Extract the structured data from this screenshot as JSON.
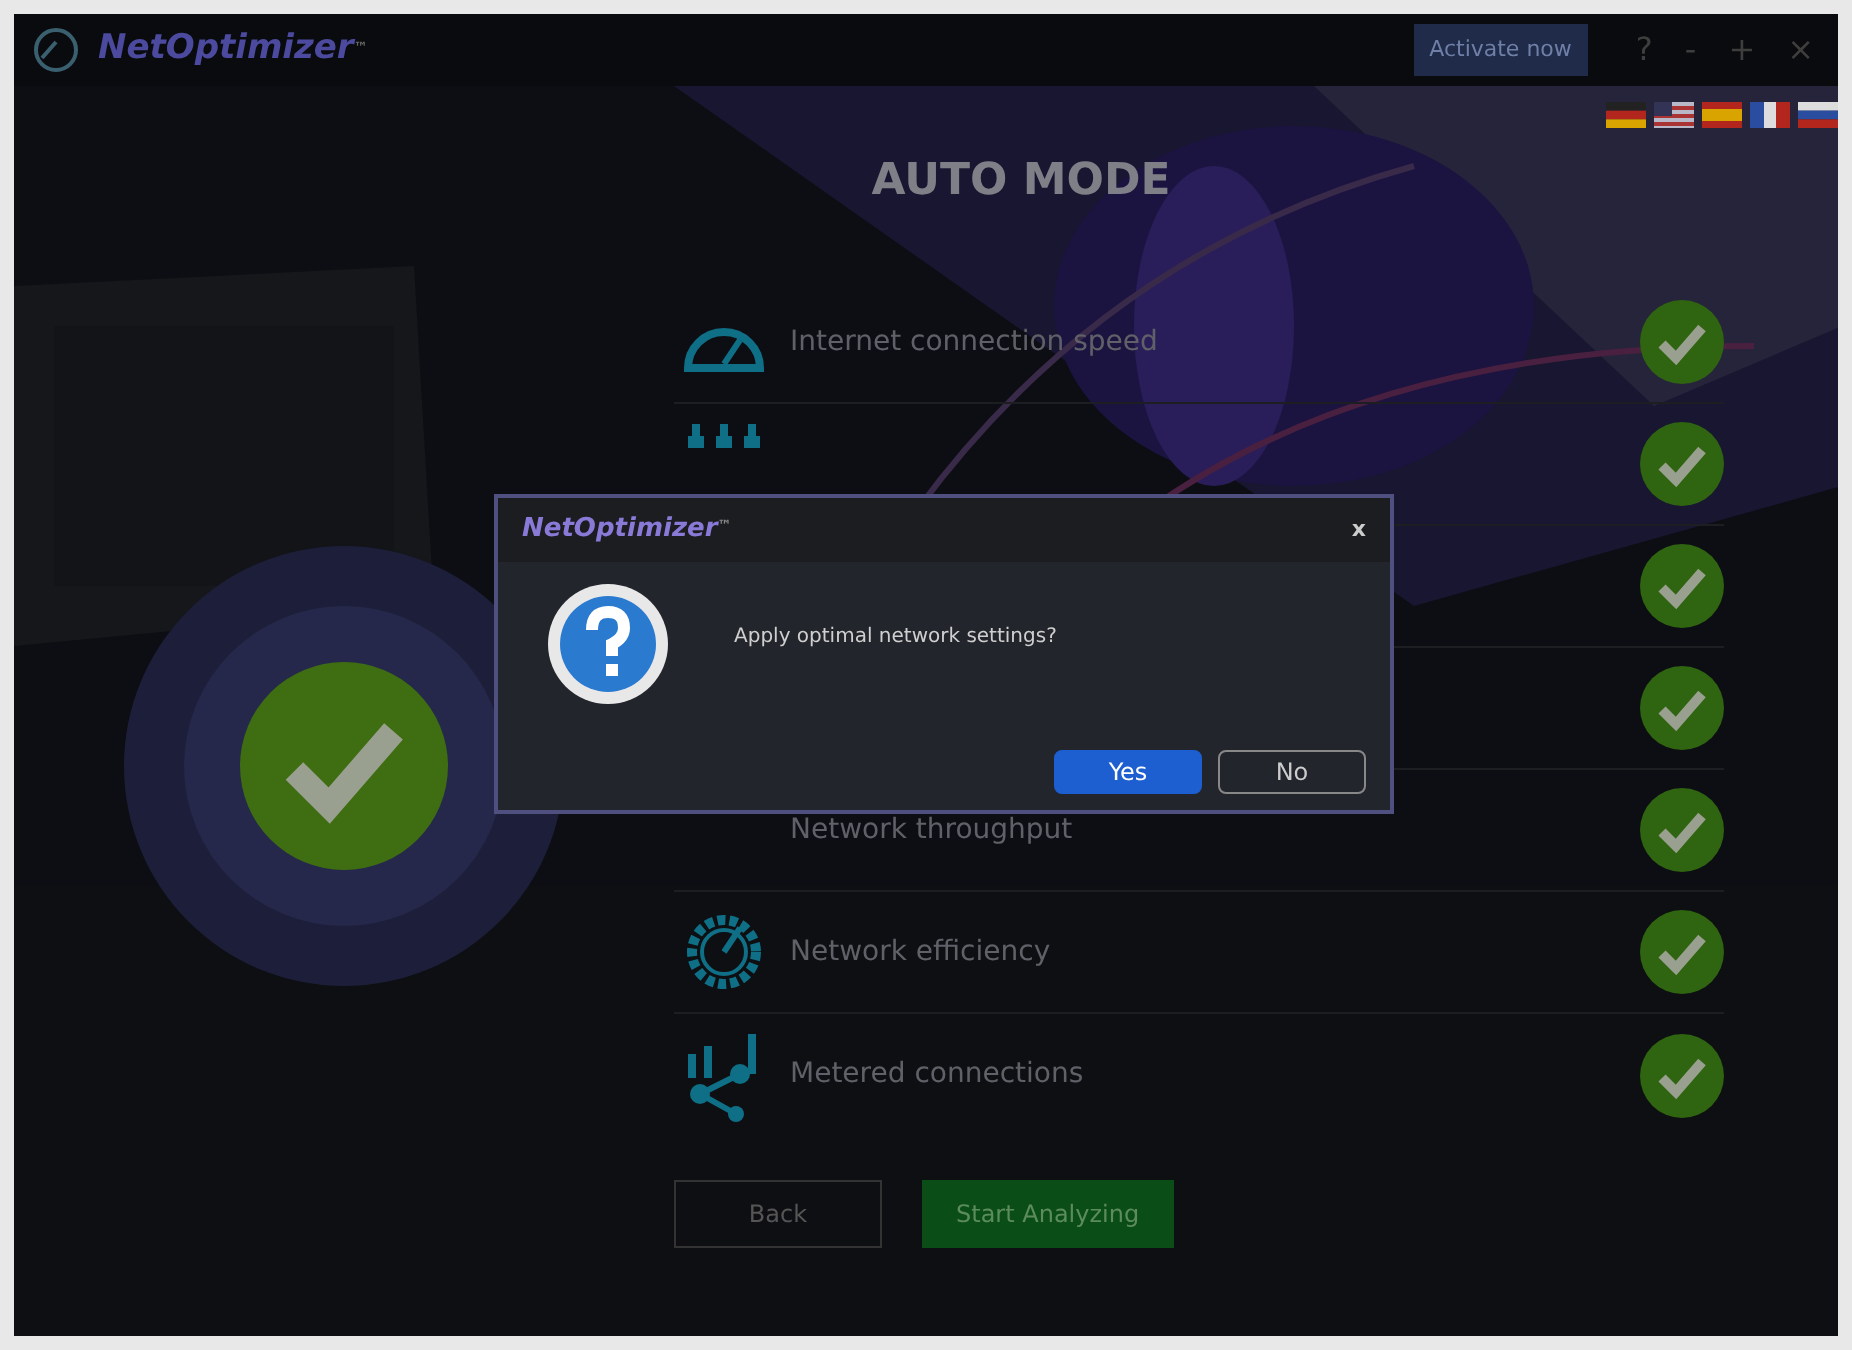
{
  "header": {
    "logo": "NetOptimizer",
    "logo_mark": "™",
    "activate": "Activate now",
    "controls": [
      "?",
      "-",
      "+",
      "×"
    ]
  },
  "flags": [
    {
      "kind": "de"
    },
    {
      "kind": "us"
    },
    {
      "kind": "es"
    },
    {
      "kind": "fr"
    },
    {
      "kind": "ru"
    }
  ],
  "title": "AUTO MODE",
  "status": {
    "checked": true
  },
  "rows": [
    {
      "kind": "gauge",
      "label": "Internet connection speed",
      "checked": true
    },
    {
      "kind": "bars",
      "checked": true
    },
    {
      "checked": true
    },
    {
      "checked": true
    },
    {
      "label": "Network throughput",
      "checked": true
    },
    {
      "kind": "gear",
      "label": "Network efficiency",
      "checked": true
    },
    {
      "kind": "nodes",
      "label": "Metered connections",
      "checked": true
    }
  ],
  "buttons": [
    {
      "kind": "outline",
      "label": "Back"
    },
    {
      "kind": "primary",
      "label": "Start Analyzing"
    }
  ],
  "dialog": {
    "logo": "NetOptimizer",
    "logo_mark": "™",
    "close": "x",
    "message": "Apply optimal network settings?",
    "buttons": [
      {
        "kind": "primary",
        "label": "Yes"
      },
      {
        "kind": "outline",
        "label": "No"
      }
    ]
  }
}
